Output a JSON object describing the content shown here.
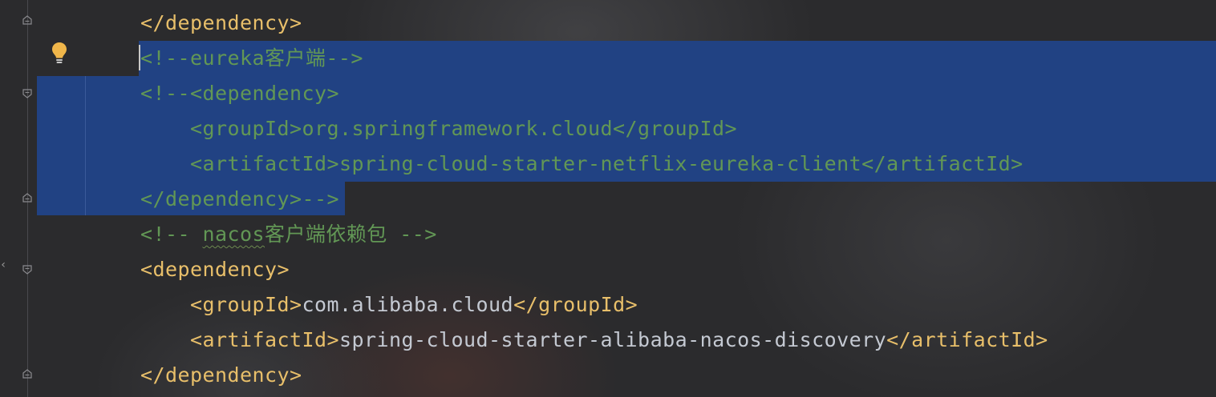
{
  "editor": {
    "lines": [
      {
        "id": "l1",
        "parts": [
          {
            "cls": "tag",
            "text": "</dependency>"
          }
        ]
      },
      {
        "id": "l2",
        "parts": [
          {
            "cls": "cmt",
            "text": "<!--eureka客户端-->"
          }
        ]
      },
      {
        "id": "l3",
        "parts": [
          {
            "cls": "cmt",
            "text": "<!--<dependency>"
          }
        ]
      },
      {
        "id": "l4",
        "parts": [
          {
            "cls": "cmt",
            "text": "    <groupId>org.springframework.cloud</groupId>"
          }
        ]
      },
      {
        "id": "l5",
        "parts": [
          {
            "cls": "cmt",
            "text": "    <artifactId>spring-cloud-starter-netflix-eureka-client</artifactId>"
          }
        ]
      },
      {
        "id": "l6",
        "parts": [
          {
            "cls": "cmt",
            "text": "</dependency>-->"
          }
        ]
      },
      {
        "id": "l7",
        "parts": [
          {
            "cls": "cmt",
            "text": "<!-- "
          },
          {
            "cls": "cmt squiggle",
            "text": "nacos"
          },
          {
            "cls": "cmt",
            "text": "客户端依赖包 -->"
          }
        ]
      },
      {
        "id": "l8",
        "parts": [
          {
            "cls": "tag",
            "text": "<dependency>"
          }
        ]
      },
      {
        "id": "l9",
        "parts": [
          {
            "cls": "tag",
            "text": "    <groupId>"
          },
          {
            "cls": "txt",
            "text": "com.alibaba.cloud"
          },
          {
            "cls": "tag",
            "text": "</groupId>"
          }
        ]
      },
      {
        "id": "l10",
        "parts": [
          {
            "cls": "tag",
            "text": "    <artifactId>"
          },
          {
            "cls": "txt",
            "text": "spring-cloud-starter-alibaba-nacos-discovery"
          },
          {
            "cls": "tag",
            "text": "</artifactId>"
          }
        ]
      },
      {
        "id": "l11",
        "parts": [
          {
            "cls": "tag",
            "text": "</dependency>"
          }
        ]
      }
    ],
    "gutter_icons": {
      "intention": "lightbulb-icon",
      "fold": "fold-marker-icon"
    },
    "colors": {
      "background": "#2b2b2d",
      "selection": "#214283",
      "xml_tag": "#e8bf6a",
      "xml_text": "#c4c9d2",
      "comment": "#629755",
      "bulb": "#f0b64a"
    }
  }
}
